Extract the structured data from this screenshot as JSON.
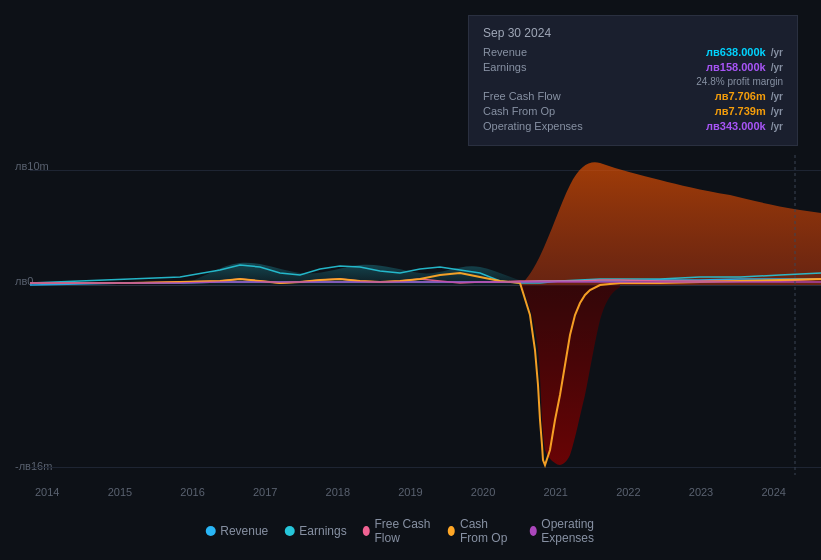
{
  "tooltip": {
    "title": "Sep 30 2024",
    "rows": [
      {
        "label": "Revenue",
        "value": "лв638.000k",
        "unit": "/yr",
        "class": "revenue"
      },
      {
        "label": "Earnings",
        "value": "лв158.000k",
        "unit": "/yr",
        "class": "earnings"
      },
      {
        "margin": "24.8% profit margin"
      },
      {
        "label": "Free Cash Flow",
        "value": "лв7.706m",
        "unit": "/yr",
        "class": "cashflow"
      },
      {
        "label": "Cash From Op",
        "value": "лв7.739m",
        "unit": "/yr",
        "class": "cashop"
      },
      {
        "label": "Operating Expenses",
        "value": "лв343.000k",
        "unit": "/yr",
        "class": "opex"
      }
    ]
  },
  "yLabels": {
    "top": "лв10m",
    "mid": "лв0",
    "bot": "-лв16m"
  },
  "xLabels": [
    "2014",
    "2015",
    "2016",
    "2017",
    "2018",
    "2019",
    "2020",
    "2021",
    "2022",
    "2023",
    "2024"
  ],
  "legend": [
    {
      "label": "Revenue",
      "color": "#29b6f6"
    },
    {
      "label": "Earnings",
      "color": "#26c6da"
    },
    {
      "label": "Free Cash Flow",
      "color": "#f06292"
    },
    {
      "label": "Cash From Op",
      "color": "#ffa726"
    },
    {
      "label": "Operating Expenses",
      "color": "#ab47bc"
    }
  ]
}
